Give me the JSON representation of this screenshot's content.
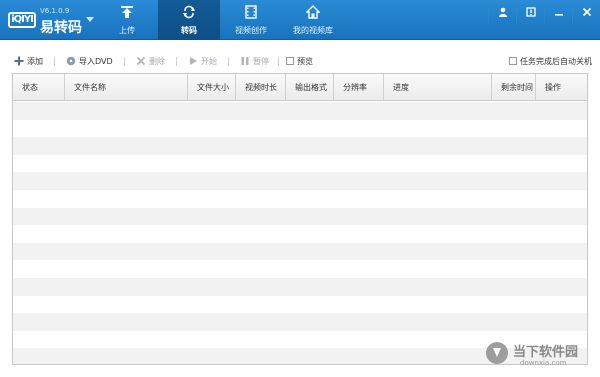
{
  "app": {
    "logo_text": "iQIYI",
    "version": "V6.1.0.9",
    "name": "易转码"
  },
  "nav": {
    "tabs": [
      {
        "label": "上传",
        "icon": "upload-icon",
        "active": false
      },
      {
        "label": "转码",
        "icon": "convert-icon",
        "active": true
      },
      {
        "label": "视频创作",
        "icon": "film-icon",
        "active": false
      },
      {
        "label": "我的视频库",
        "icon": "home-icon",
        "active": false
      }
    ]
  },
  "window_controls": [
    "user-icon",
    "info-icon",
    "minimize-icon",
    "close-icon"
  ],
  "toolbar": {
    "add": "添加",
    "import_dvd": "导入DVD",
    "delete": "删除",
    "start": "开始",
    "pause": "暂停",
    "preview": "预览",
    "auto_shutdown": "任务完成后自动关机"
  },
  "table": {
    "columns": [
      "状态",
      "文件名称",
      "文件大小",
      "视频时长",
      "输出格式",
      "分辨率",
      "进度",
      "剩余时间",
      "操作"
    ],
    "rows": []
  },
  "watermark": {
    "title": "当下软件园",
    "subtitle": "downxia.com"
  },
  "colors": {
    "accent": "#1e7cc8",
    "active_tab": "#0f5590"
  }
}
